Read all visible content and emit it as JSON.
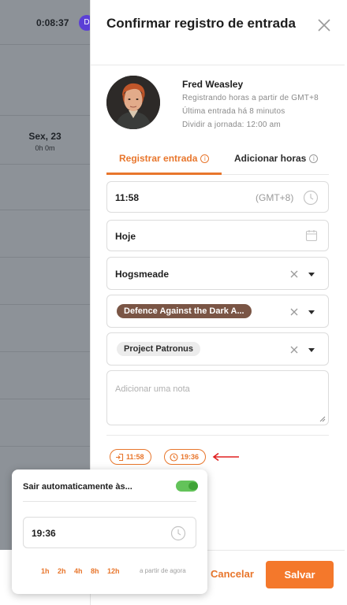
{
  "background": {
    "timer": "0:08:37",
    "badge": "D",
    "day_label": "Sex, 23",
    "day_hours": "0h 0m"
  },
  "dialog": {
    "title": "Confirmar registro de entrada",
    "user": {
      "name": "Fred Weasley",
      "line1": "Registrando horas a partir de GMT+8",
      "line2": "Última entrada há 8 minutos",
      "line3": "Dividir a jornada: 12:00 am"
    },
    "tabs": [
      {
        "label": "Registrar entrada",
        "active": true
      },
      {
        "label": "Adicionar horas",
        "active": false
      }
    ],
    "time_field": {
      "value": "11:58",
      "timezone": "(GMT+8)"
    },
    "date_field": {
      "value": "Hoje"
    },
    "location_field": {
      "value": "Hogsmeade"
    },
    "activity_field": {
      "value": "Defence Against the Dark A..."
    },
    "project_field": {
      "value": "Project Patronus"
    },
    "note_field": {
      "placeholder": "Adicionar uma nota"
    },
    "pills": [
      {
        "label": "11:58",
        "icon": "clock-in-icon"
      },
      {
        "label": "19:36",
        "icon": "clock-out-icon"
      }
    ],
    "cancel_label": "Cancelar",
    "save_label": "Salvar"
  },
  "auto_clockout_popup": {
    "title": "Sair automaticamente às...",
    "enabled": true,
    "time": "19:36",
    "quick_options": [
      "1h",
      "2h",
      "4h",
      "8h",
      "12h"
    ],
    "quick_note": "a partir de agora"
  },
  "colors": {
    "accent": "#e8762c",
    "save_button": "#f4782b",
    "activity_chip": "#7a5545",
    "toggle_on": "#63c35a",
    "arrow": "#e02020"
  }
}
